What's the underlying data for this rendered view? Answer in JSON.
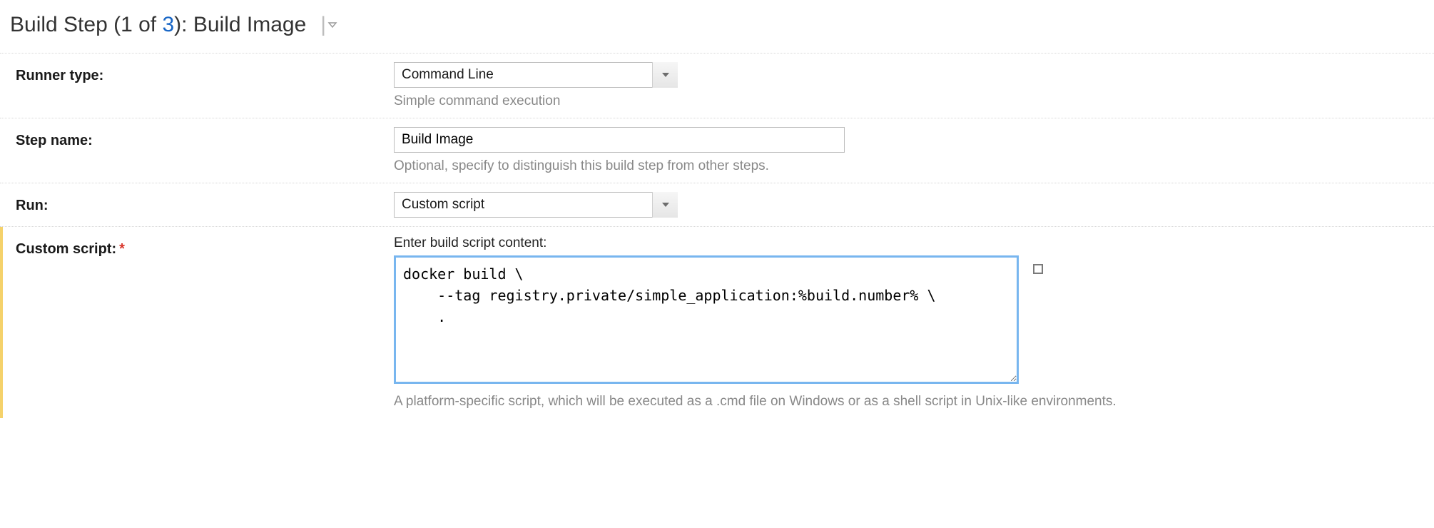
{
  "heading": {
    "prefix": "Build Step (",
    "current": "1",
    "of_word": " of ",
    "total": "3",
    "suffix": "): ",
    "title": "Build Image"
  },
  "runner_type": {
    "label": "Runner type:",
    "value": "Command Line",
    "hint": "Simple command execution"
  },
  "step_name": {
    "label": "Step name:",
    "value": "Build Image",
    "hint": "Optional, specify to distinguish this build step from other steps."
  },
  "run": {
    "label": "Run:",
    "value": "Custom script"
  },
  "custom_script": {
    "label": "Custom script:",
    "field_header": "Enter build script content:",
    "value": "docker build \\\n    --tag registry.private/simple_application:%build.number% \\\n    .",
    "hint": "A platform-specific script, which will be executed as a .cmd file on Windows or as a shell script in Unix-like environments."
  }
}
